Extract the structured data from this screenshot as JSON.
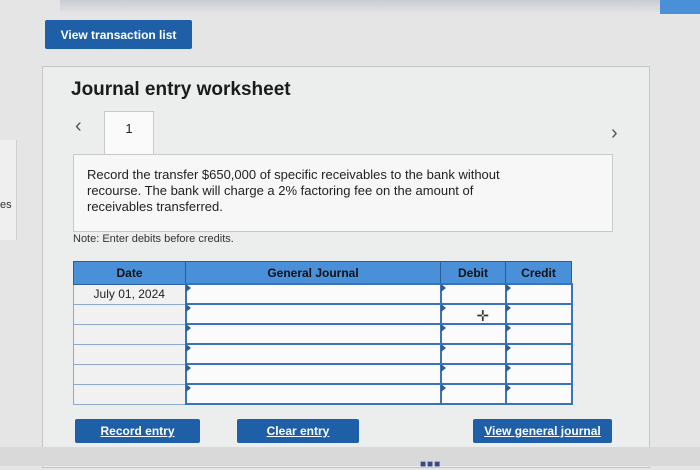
{
  "header": {
    "view_transaction_list": "View transaction list"
  },
  "worksheet": {
    "title": "Journal entry worksheet",
    "current_tab": "1",
    "description": "Record the transfer $650,000 of specific receivables to the bank without recourse. The bank will charge a 2% factoring fee on the amount of receivables transferred.",
    "note": "Note: Enter debits before credits."
  },
  "table": {
    "columns": [
      "Date",
      "General Journal",
      "Debit",
      "Credit"
    ],
    "rows": [
      {
        "date": "July 01, 2024",
        "account": "",
        "debit": "",
        "credit": ""
      },
      {
        "date": "",
        "account": "",
        "debit": "",
        "credit": ""
      },
      {
        "date": "",
        "account": "",
        "debit": "",
        "credit": ""
      },
      {
        "date": "",
        "account": "",
        "debit": "",
        "credit": ""
      },
      {
        "date": "",
        "account": "",
        "debit": "",
        "credit": ""
      },
      {
        "date": "",
        "account": "",
        "debit": "",
        "credit": ""
      }
    ]
  },
  "buttons": {
    "record_entry": "Record entry",
    "clear_entry": "Clear entry",
    "view_general_journal": "View general journal"
  },
  "side": {
    "left_fragment": "es"
  },
  "colors": {
    "primary": "#1e5fa8",
    "header_blue": "#4a90d9"
  },
  "icons": [
    "chevron-left-icon",
    "chevron-right-icon",
    "move-cursor-icon"
  ]
}
